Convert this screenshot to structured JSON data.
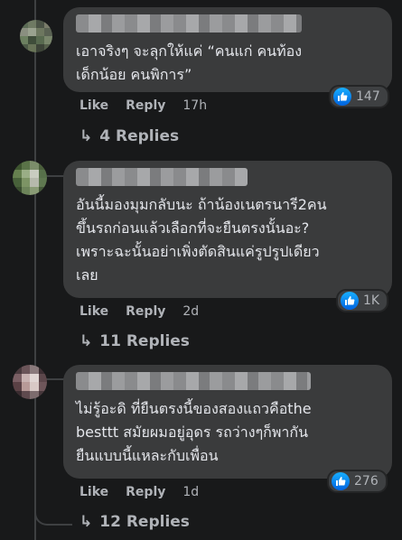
{
  "comments": [
    {
      "text": "เอาจริงๆ จะลุกให้แค่ “คนแก่ คนท้อง\nเด็กน้อย คนพิการ”",
      "reactions": "147",
      "like": "Like",
      "reply": "Reply",
      "time": "17h",
      "replies": "4 Replies"
    },
    {
      "text": "อันนี้มองมุมกลับนะ ถ้าน้องเนตรนารี2คน\nขึ้นรถก่อนแล้วเลือกที่จะยืนตรงนั้นอะ?\nเพราะฉะนั้นอย่าเพิ่งตัดสินแค่รูปรูปเดียว\nเลย",
      "reactions": "1K",
      "like": "Like",
      "reply": "Reply",
      "time": "2d",
      "replies": "11 Replies"
    },
    {
      "text": "ไม่รู้อะดิ ที่ยืนตรงนี้ของสองแถวคือthe\nbesttt สมัยผมอยู่อุดร รถว่างๆก็พากัน\nยืนแบบนี้แหละกับเพื่อน",
      "reactions": "276",
      "like": "Like",
      "reply": "Reply",
      "time": "1d",
      "replies": "12 Replies"
    }
  ]
}
